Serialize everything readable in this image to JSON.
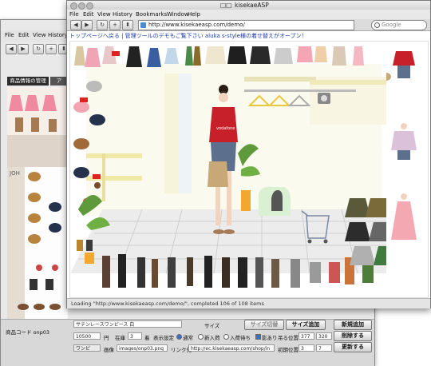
{
  "back_window": {
    "menu": [
      "File",
      "Edit",
      "View",
      "History"
    ],
    "tab_label": "商品情報の管理",
    "tab_label2": "ア",
    "toolbar_buttons": [
      "◀",
      "▶",
      "↻",
      "+",
      "⬍"
    ]
  },
  "front_window": {
    "title": "kisekaeASP",
    "title_prefix": "□□",
    "menu": [
      "File",
      "Edit",
      "View",
      "History",
      "Bookmarks",
      "Window",
      "Help"
    ],
    "toolbar_buttons": [
      "◀",
      "▶",
      "↻",
      "+",
      "⬍"
    ],
    "url": "http://www.kisekaeasp.com/demo/",
    "search_placeholder": "Google",
    "links_text": "トップページへ戻る | 管理ツールのデモもご覧下さい aluka s-style様の着せ替えがオープン！",
    "status": "Loading \"http://www.kisekaeasp.com/demo/\", completed 106 of 108 items"
  },
  "form": {
    "product_code_label": "商品コード onp03",
    "product_name": "サテンレースワンピース 白",
    "price": "10500",
    "price_unit": "円",
    "stock_label": "在庫",
    "stock_value": "3",
    "count_unit": "着",
    "display_label": "表示設定",
    "radio_normal": "通常",
    "radio_new": "新入荷",
    "radio_restock": "入荷待ち",
    "size_label": "サイズ",
    "size_switch_button": "サイズ切替",
    "add_size_button": "サイズ追加",
    "add_new_button": "新規追加",
    "delete_button": "削除する",
    "update_button": "更新する",
    "category_value": "ワンピ",
    "image_label": "画像",
    "image_value": "images/onp03.png",
    "link_label": "リンク先",
    "link_value": "http://ec.kisekaeasp.com/shop/in",
    "shadow_label": "影あり",
    "shadow_checked": true,
    "hanger_label": "吊る",
    "coord_label": "吊る位置",
    "coord_x": "377",
    "coord_y": "320",
    "init_label": "初期位置",
    "init_x": "3",
    "init_y": "7"
  },
  "colors": {
    "link_blue": "#1f3fa8",
    "shirt_red": "#c8202a",
    "jeans_blue": "#5c6f8c"
  }
}
